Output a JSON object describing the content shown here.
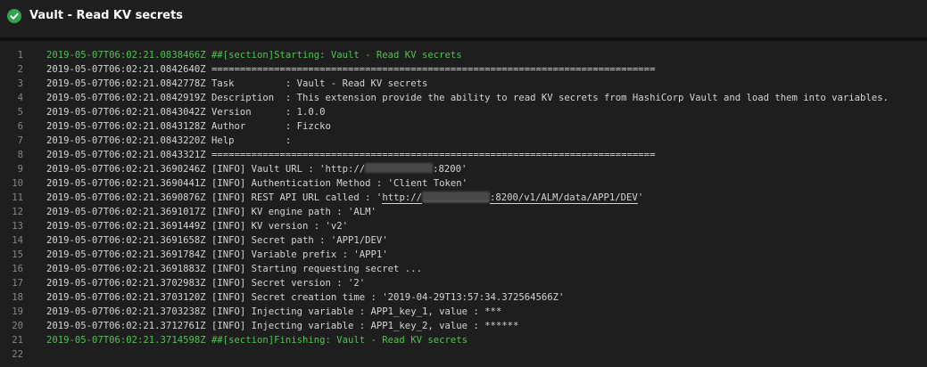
{
  "header": {
    "title": "Vault - Read KV secrets",
    "status_icon": "check-circle-icon",
    "status_color": "#2da44e"
  },
  "colors": {
    "background": "#1e1e1e",
    "text": "#d4d4d4",
    "section_text": "#4ec34e",
    "line_number": "#858585"
  },
  "log": {
    "lines": [
      {
        "n": "1",
        "type": "section",
        "parts": [
          {
            "t": "2019-05-07T06:02:21.0838466Z ##[section]Starting: Vault - Read KV secrets"
          }
        ]
      },
      {
        "n": "2",
        "type": "normal",
        "parts": [
          {
            "t": "2019-05-07T06:02:21.0842640Z =============================================================================="
          }
        ]
      },
      {
        "n": "3",
        "type": "normal",
        "parts": [
          {
            "t": "2019-05-07T06:02:21.0842778Z Task         : Vault - Read KV secrets"
          }
        ]
      },
      {
        "n": "4",
        "type": "normal",
        "parts": [
          {
            "t": "2019-05-07T06:02:21.0842919Z Description  : This extension provide the ability to read KV secrets from HashiCorp Vault and load them into variables."
          }
        ]
      },
      {
        "n": "5",
        "type": "normal",
        "parts": [
          {
            "t": "2019-05-07T06:02:21.0843042Z Version      : 1.0.0"
          }
        ]
      },
      {
        "n": "6",
        "type": "normal",
        "parts": [
          {
            "t": "2019-05-07T06:02:21.0843128Z Author       : Fizcko"
          }
        ]
      },
      {
        "n": "7",
        "type": "normal",
        "parts": [
          {
            "t": "2019-05-07T06:02:21.0843220Z Help         :"
          }
        ]
      },
      {
        "n": "8",
        "type": "normal",
        "parts": [
          {
            "t": "2019-05-07T06:02:21.0843321Z =============================================================================="
          }
        ]
      },
      {
        "n": "9",
        "type": "normal",
        "parts": [
          {
            "t": "2019-05-07T06:02:21.3690246Z [INFO] Vault URL : 'http://"
          },
          {
            "redact": true
          },
          {
            "t": ":8200'"
          }
        ]
      },
      {
        "n": "10",
        "type": "normal",
        "parts": [
          {
            "t": "2019-05-07T06:02:21.3690441Z [INFO] Authentication Method : 'Client Token'"
          }
        ]
      },
      {
        "n": "11",
        "type": "normal",
        "parts": [
          {
            "t": "2019-05-07T06:02:21.3690876Z [INFO] REST API URL called : '"
          },
          {
            "t": "http://",
            "u": true
          },
          {
            "redact": true,
            "u": true
          },
          {
            "t": ":8200/v1/ALM/data/APP1/DEV",
            "u": true
          },
          {
            "t": "'"
          }
        ]
      },
      {
        "n": "12",
        "type": "normal",
        "parts": [
          {
            "t": "2019-05-07T06:02:21.3691017Z [INFO] KV engine path : 'ALM'"
          }
        ]
      },
      {
        "n": "13",
        "type": "normal",
        "parts": [
          {
            "t": "2019-05-07T06:02:21.3691449Z [INFO] KV version : 'v2'"
          }
        ]
      },
      {
        "n": "14",
        "type": "normal",
        "parts": [
          {
            "t": "2019-05-07T06:02:21.3691658Z [INFO] Secret path : 'APP1/DEV'"
          }
        ]
      },
      {
        "n": "15",
        "type": "normal",
        "parts": [
          {
            "t": "2019-05-07T06:02:21.3691784Z [INFO] Variable prefix : 'APP1'"
          }
        ]
      },
      {
        "n": "16",
        "type": "normal",
        "parts": [
          {
            "t": "2019-05-07T06:02:21.3691883Z [INFO] Starting requesting secret ..."
          }
        ]
      },
      {
        "n": "17",
        "type": "normal",
        "parts": [
          {
            "t": "2019-05-07T06:02:21.3702983Z [INFO] Secret version : '2'"
          }
        ]
      },
      {
        "n": "18",
        "type": "normal",
        "parts": [
          {
            "t": "2019-05-07T06:02:21.3703120Z [INFO] Secret creation time : '2019-04-29T13:57:34.372564566Z'"
          }
        ]
      },
      {
        "n": "19",
        "type": "normal",
        "parts": [
          {
            "t": "2019-05-07T06:02:21.3703238Z [INFO] Injecting variable : APP1_key_1, value : ***"
          }
        ]
      },
      {
        "n": "20",
        "type": "normal",
        "parts": [
          {
            "t": "2019-05-07T06:02:21.3712761Z [INFO] Injecting variable : APP1_key_2, value : ******"
          }
        ]
      },
      {
        "n": "21",
        "type": "section",
        "parts": [
          {
            "t": "2019-05-07T06:02:21.3714598Z ##[section]Finishing: Vault - Read KV secrets"
          }
        ]
      },
      {
        "n": "22",
        "type": "normal",
        "parts": [
          {
            "t": ""
          }
        ]
      }
    ]
  }
}
